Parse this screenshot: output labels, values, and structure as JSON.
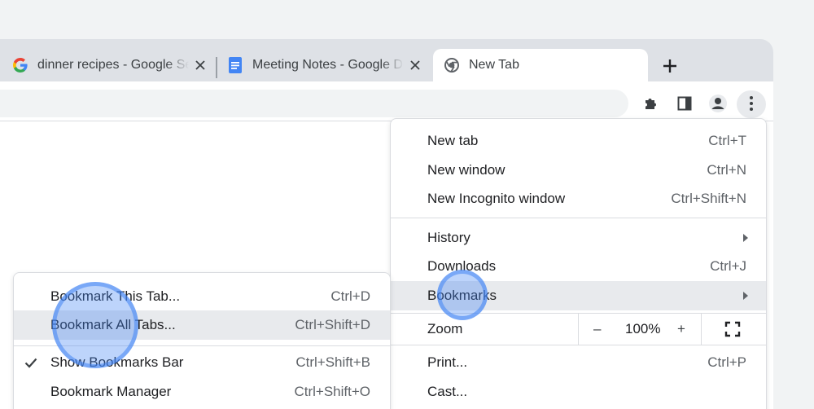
{
  "tabs": [
    {
      "title": "dinner recipes - Google Search",
      "favicon": "google-g-icon",
      "active": false
    },
    {
      "title": "Meeting Notes - Google Docs",
      "favicon": "google-docs-icon",
      "active": false
    },
    {
      "title": "New Tab",
      "favicon": "chrome-icon",
      "active": true
    }
  ],
  "new_tab_symbol": "+",
  "toolbar": {
    "icons": [
      "extensions-puzzle-icon",
      "side-panel-icon",
      "profile-avatar-icon",
      "kebab-menu-icon"
    ]
  },
  "menu": {
    "items": [
      {
        "label": "New tab",
        "shortcut": "Ctrl+T"
      },
      {
        "label": "New window",
        "shortcut": "Ctrl+N"
      },
      {
        "label": "New Incognito window",
        "shortcut": "Ctrl+Shift+N"
      },
      {
        "label": "History",
        "shortcut": ""
      },
      {
        "label": "Downloads",
        "shortcut": "Ctrl+J"
      },
      {
        "label": "Bookmarks",
        "shortcut": ""
      },
      {
        "label": "Print...",
        "shortcut": "Ctrl+P"
      },
      {
        "label": "Cast...",
        "shortcut": ""
      }
    ],
    "zoom": {
      "label": "Zoom",
      "minus": "–",
      "value": "100%",
      "plus": "+"
    }
  },
  "bookmarks_submenu": {
    "items": [
      {
        "label": "Bookmark This Tab...",
        "shortcut": "Ctrl+D"
      },
      {
        "label": "Bookmark All Tabs...",
        "shortcut": "Ctrl+Shift+D"
      },
      {
        "label": "Show Bookmarks Bar",
        "shortcut": "Ctrl+Shift+B",
        "checked": true
      },
      {
        "label": "Bookmark Manager",
        "shortcut": "Ctrl+Shift+O"
      }
    ]
  },
  "colors": {
    "highlight": "#e8eaed",
    "tap_indicator": "#4285f4",
    "tab_strip": "#dee1e6"
  }
}
